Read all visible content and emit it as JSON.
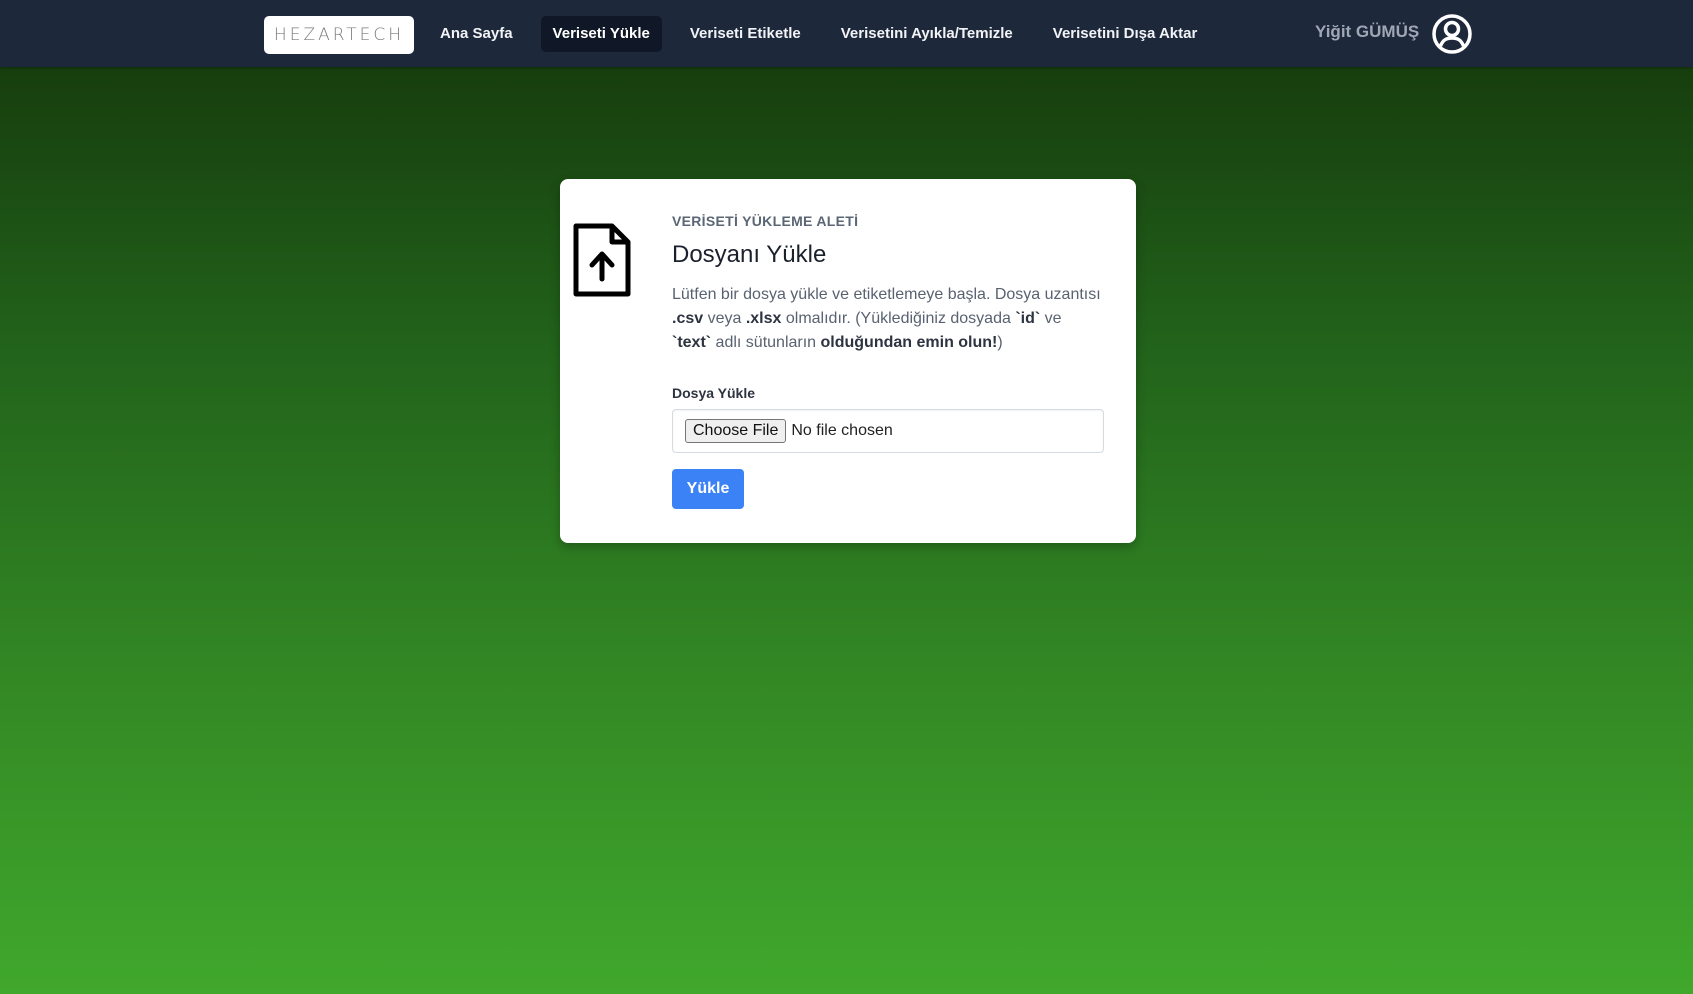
{
  "nav": {
    "logo_text": "HEZARTECH",
    "links": [
      {
        "label": "Ana Sayfa"
      },
      {
        "label": "Veriseti Yükle"
      },
      {
        "label": "Veriseti Etiketle"
      },
      {
        "label": "Verisetini Ayıkla/Temizle"
      },
      {
        "label": "Verisetini Dışa Aktar"
      }
    ],
    "active_index": 1,
    "user_name": "Yiğit GÜMÜŞ",
    "user_icon": "user-circle-icon"
  },
  "card": {
    "icon": "file-upload-icon",
    "kicker": "VERİSETİ YÜKLEME ALETİ",
    "title": "Dosyanı Yükle",
    "description": {
      "part1": "Lütfen bir dosya yükle ve etiketlemeye başla. Dosya uzantısı ",
      "ext_csv": ".csv",
      "part2": " veya ",
      "ext_xlsx": ".xlsx",
      "part3": " olmalıdır. (Yüklediğiniz dosyada ",
      "col_id": "`id`",
      "part4": " ve ",
      "col_text": "`text`",
      "part5": " adlı sütunların ",
      "emphasis": "olduğundan emin olun!",
      "part6": ")"
    },
    "field_label": "Dosya Yükle",
    "choose_button": "Choose File",
    "no_file_text": "No file chosen",
    "submit_label": "Yükle"
  },
  "colors": {
    "navbar": "#1e283b",
    "active_nav": "#101827",
    "primary_button": "#3b82f6",
    "bg_top": "#14350b",
    "bg_bottom": "#40a82c"
  }
}
